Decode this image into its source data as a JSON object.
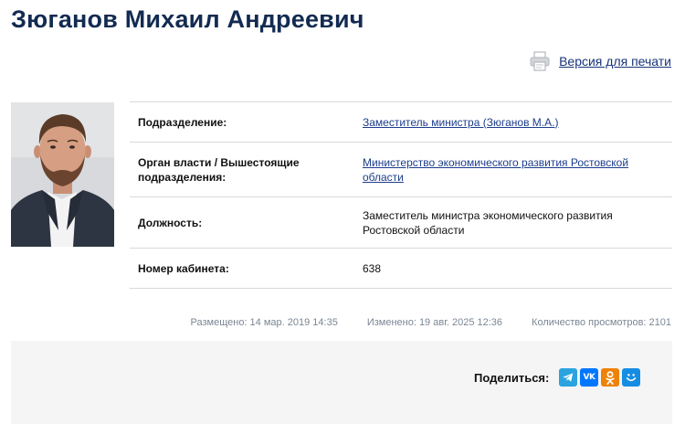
{
  "page": {
    "title": "Зюганов Михаил Андреевич",
    "print_label": "Версия для печати"
  },
  "profile": {
    "fields": [
      {
        "label": "Подразделение:",
        "value": "Заместитель министра (Зюганов М.А.)",
        "link": true
      },
      {
        "label": "Орган власти / Вышестоящие подразделения:",
        "value": "Министерство экономического развития Ростовской области",
        "link": true
      },
      {
        "label": "Должность:",
        "value": "Заместитель министра экономического развития Ростовской области",
        "link": false
      },
      {
        "label": "Номер кабинета:",
        "value": "638",
        "link": false
      }
    ]
  },
  "meta": {
    "posted": "Размещено: 14 мар. 2019 14:35",
    "modified": "Изменено: 19 авг. 2025 12:36",
    "views": "Количество просмотров: 2101"
  },
  "share": {
    "label": "Поделиться:",
    "networks": [
      {
        "icon": "telegram-icon",
        "color": "#2aa3e0"
      },
      {
        "icon": "vk-icon",
        "color": "#0077ff"
      },
      {
        "icon": "odnoklassniki-icon",
        "color": "#ee8208"
      },
      {
        "icon": "moimir-icon",
        "color": "#168de2"
      }
    ]
  },
  "colors": {
    "title": "#132b52",
    "link": "#1c3e8c",
    "meta_text": "#7a8694",
    "share_bar_bg": "#f5f5f6"
  }
}
